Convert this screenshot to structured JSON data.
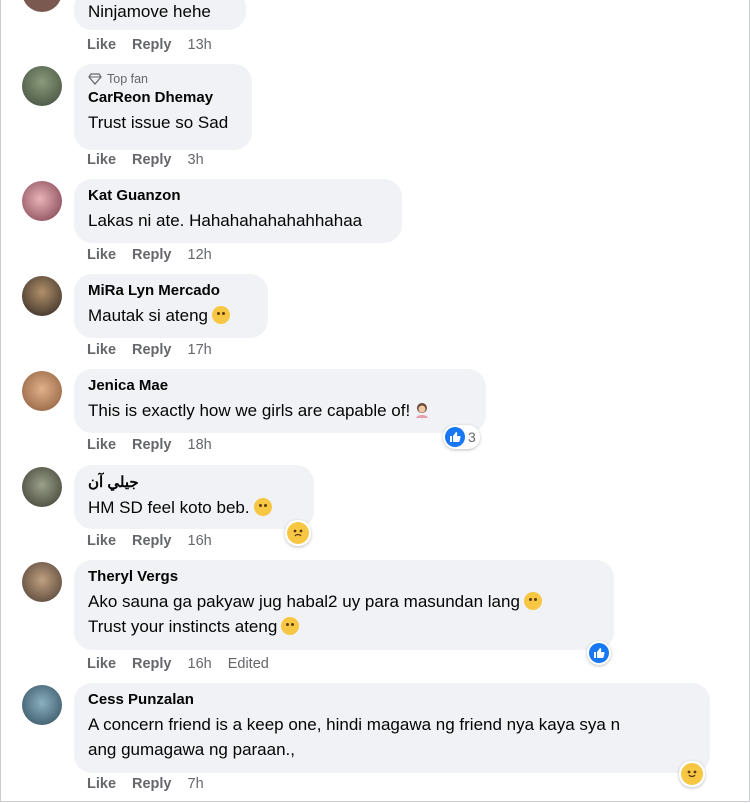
{
  "actions": {
    "like": "Like",
    "reply": "Reply"
  },
  "comments": [
    {
      "name": "",
      "top_fan": "",
      "lines": [
        "Ninjamove hehe"
      ],
      "time": "13h",
      "edited": "",
      "reaction_count": ""
    },
    {
      "name": "CarReon Dhemay",
      "top_fan": "Top fan",
      "lines": [
        "Trust issue so Sad"
      ],
      "time": "3h",
      "edited": "",
      "reaction_count": ""
    },
    {
      "name": "Kat Guanzon",
      "top_fan": "",
      "lines": [
        "Lakas ni ate. Hahahahahahahhahaa"
      ],
      "time": "12h",
      "edited": "",
      "reaction_count": ""
    },
    {
      "name": "MiRa Lyn Mercado",
      "top_fan": "",
      "lines": [
        "Mautak si ateng"
      ],
      "time": "17h",
      "edited": "",
      "reaction_count": ""
    },
    {
      "name": "Jenica Mae",
      "top_fan": "",
      "lines": [
        "This is exactly how we girls are capable of!"
      ],
      "time": "18h",
      "edited": "",
      "reaction_count": "3"
    },
    {
      "name": "جيلي آن",
      "top_fan": "",
      "lines": [
        "HM SD feel koto beb."
      ],
      "time": "16h",
      "edited": "",
      "reaction_count": ""
    },
    {
      "name": "Theryl Vergs",
      "top_fan": "",
      "lines": [
        "Ako sauna ga pakyaw jug habal2 uy para masundan lang",
        "Trust your instincts ateng"
      ],
      "time": "16h",
      "edited": "Edited",
      "reaction_count": ""
    },
    {
      "name": "Cess Punzalan",
      "top_fan": "",
      "lines": [
        "A concern friend is a keep one, hindi magawa ng friend nya kaya sya n",
        "ang gumagawa ng paraan.,"
      ],
      "time": "7h",
      "edited": "",
      "reaction_count": ""
    }
  ],
  "icons": [
    "diamond-icon",
    "laughing-emoji-icon",
    "smile-emoji-icon",
    "sad-emoji-icon",
    "like-reaction-icon",
    "care-reaction-icon",
    "person-emoji-icon"
  ],
  "colors": {
    "bubble": "#f0f2f5",
    "secondary_text": "#65676b",
    "like_blue": "#1877f2",
    "emoji_yellow": "#f7c744"
  }
}
